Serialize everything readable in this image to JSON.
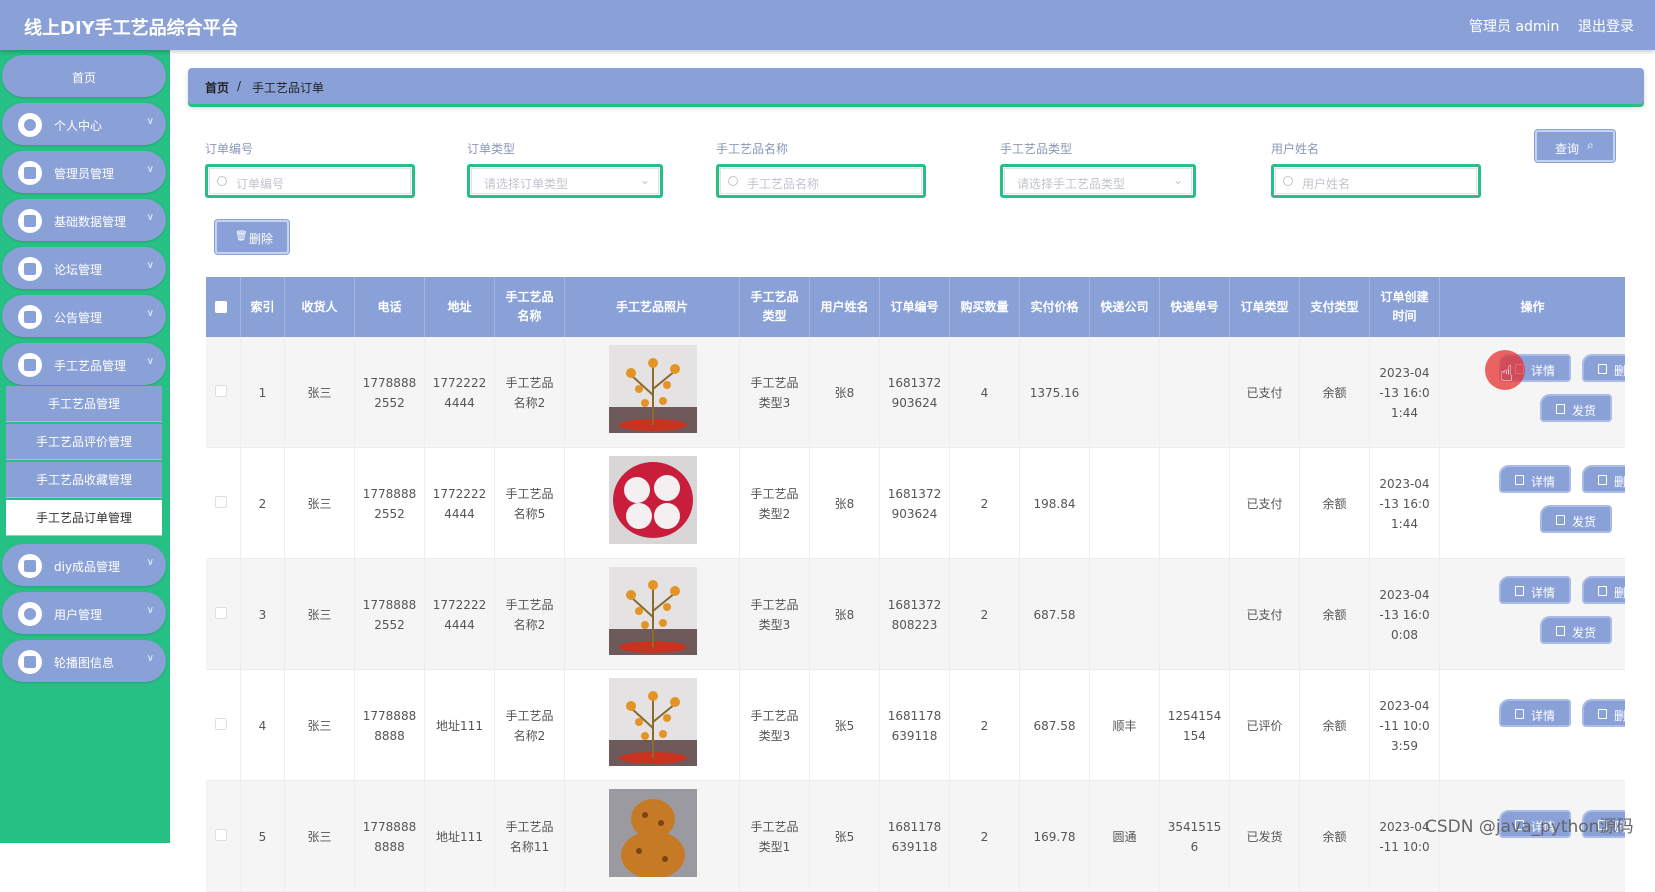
{
  "app": {
    "title": "线上DIY手工艺品综合平台",
    "admin_label": "管理员 admin",
    "logout": "退出登录"
  },
  "sidebar": {
    "home": "首页",
    "items": [
      {
        "label": "个人中心"
      },
      {
        "label": "管理员管理"
      },
      {
        "label": "基础数据管理"
      },
      {
        "label": "论坛管理"
      },
      {
        "label": "公告管理"
      },
      {
        "label": "手工艺品管理"
      },
      {
        "label": "diy成品管理"
      },
      {
        "label": "用户管理"
      },
      {
        "label": "轮播图信息"
      }
    ],
    "submenu": [
      "手工艺品管理",
      "手工艺品评价管理",
      "手工艺品收藏管理",
      "手工艺品订单管理"
    ],
    "chevron": "chevron-down-icon"
  },
  "breadcrumb": {
    "home": "首页",
    "sep": "/",
    "current": "手工艺品订单"
  },
  "search": {
    "fields": [
      {
        "label": "订单编号",
        "placeholder": "订单编号"
      },
      {
        "label": "订单类型",
        "placeholder": "请选择订单类型"
      },
      {
        "label": "手工艺品名称",
        "placeholder": "手工艺品名称"
      },
      {
        "label": "手工艺品类型",
        "placeholder": "请选择手工艺品类型"
      },
      {
        "label": "用户姓名",
        "placeholder": "用户姓名"
      }
    ],
    "query_button": "查询",
    "delete_button": "删除"
  },
  "table": {
    "headers": [
      "索引",
      "收货人",
      "电话",
      "地址",
      "手工艺品名称",
      "手工艺品照片",
      "手工艺品类型",
      "用户姓名",
      "订单编号",
      "购买数量",
      "实付价格",
      "快递公司",
      "快递单号",
      "订单类型",
      "支付类型",
      "订单创建时间",
      "操作"
    ],
    "actions": {
      "detail": "详情",
      "delete": "删除",
      "ship": "发货"
    },
    "rows": [
      {
        "index": "1",
        "receiver": "张三",
        "phone": [
          "1778888",
          "2552"
        ],
        "address": [
          "1772222",
          "4444"
        ],
        "name": [
          "手工艺品",
          "名称2"
        ],
        "type": [
          "手工艺品",
          "类型3"
        ],
        "user": "张8",
        "order_no": [
          "1681372",
          "903624"
        ],
        "qty": "4",
        "price": "1375.16",
        "courier": "",
        "tracking": [
          "",
          ""
        ],
        "order_type": "已支付",
        "pay_type": "余额",
        "time": [
          "2023-04",
          "-13 16:0",
          "1:44"
        ]
      },
      {
        "index": "2",
        "receiver": "张三",
        "phone": [
          "1778888",
          "2552"
        ],
        "address": [
          "1772222",
          "4444"
        ],
        "name": [
          "手工艺品",
          "名称5"
        ],
        "type": [
          "手工艺品",
          "类型2"
        ],
        "user": "张8",
        "order_no": [
          "1681372",
          "903624"
        ],
        "qty": "2",
        "price": "198.84",
        "courier": "",
        "tracking": [
          "",
          ""
        ],
        "order_type": "已支付",
        "pay_type": "余额",
        "time": [
          "2023-04",
          "-13 16:0",
          "1:44"
        ]
      },
      {
        "index": "3",
        "receiver": "张三",
        "phone": [
          "1778888",
          "2552"
        ],
        "address": [
          "1772222",
          "4444"
        ],
        "name": [
          "手工艺品",
          "名称2"
        ],
        "type": [
          "手工艺品",
          "类型3"
        ],
        "user": "张8",
        "order_no": [
          "1681372",
          "808223"
        ],
        "qty": "2",
        "price": "687.58",
        "courier": "",
        "tracking": [
          "",
          ""
        ],
        "order_type": "已支付",
        "pay_type": "余额",
        "time": [
          "2023-04",
          "-13 16:0",
          "0:08"
        ]
      },
      {
        "index": "4",
        "receiver": "张三",
        "phone": [
          "1778888",
          "8888"
        ],
        "address": [
          "地址111",
          ""
        ],
        "name": [
          "手工艺品",
          "名称2"
        ],
        "type": [
          "手工艺品",
          "类型3"
        ],
        "user": "张5",
        "order_no": [
          "1681178",
          "639118"
        ],
        "qty": "2",
        "price": "687.58",
        "courier": "顺丰",
        "tracking": [
          "1254154",
          "154"
        ],
        "order_type": "已评价",
        "pay_type": "余额",
        "time": [
          "2023-04",
          "-11 10:0",
          "3:59"
        ]
      },
      {
        "index": "5",
        "receiver": "张三",
        "phone": [
          "1778888",
          "8888"
        ],
        "address": [
          "地址111",
          ""
        ],
        "name": [
          "手工艺品",
          "名称11"
        ],
        "type": [
          "手工艺品",
          "类型1"
        ],
        "user": "张5",
        "order_no": [
          "1681178",
          "639118"
        ],
        "qty": "2",
        "price": "169.78",
        "courier": "圆通",
        "tracking": [
          "3541515",
          "6"
        ],
        "order_type": "已发货",
        "pay_type": "余额",
        "time": [
          "2023-04",
          "-11 10:0",
          ""
        ]
      }
    ]
  },
  "watermark": "CSDN @java_python源码",
  "colors": {
    "primary": "#8aa1d8",
    "sidebar": "#27c084",
    "accent_border": "#27c084"
  }
}
